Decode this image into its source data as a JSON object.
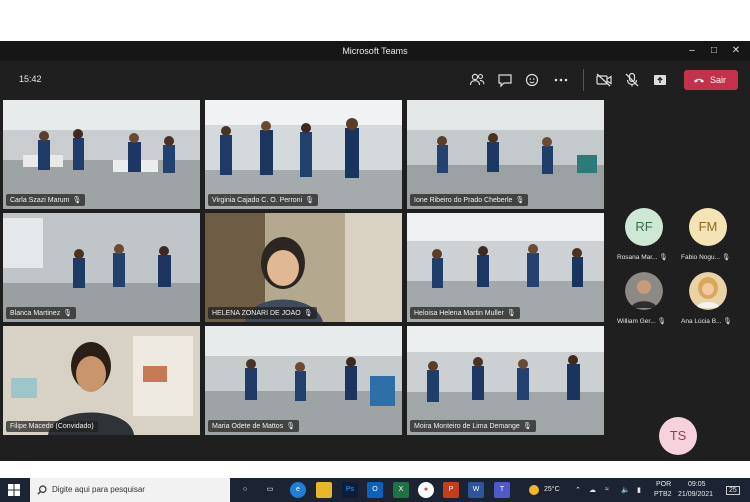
{
  "window": {
    "title": "Microsoft Teams"
  },
  "toolbar": {
    "time": "15:42",
    "leave_label": "Sair"
  },
  "participants_grid": [
    {
      "name": "Carla Szazi Marum"
    },
    {
      "name": "Virginia Cajado C. O. Perroni"
    },
    {
      "name": "Ione Ribeiro do Prado Cheberle"
    },
    {
      "name": "Blanca Martinez"
    },
    {
      "name": "HELENA ZONARI DE JOAO"
    },
    {
      "name": "Heloisa Helena Martin Muller"
    },
    {
      "name": "Filipe Macedo (Convidado)"
    },
    {
      "name": "Maria Odete de Mattos"
    },
    {
      "name": "Moira Monteiro de Lima Demange"
    }
  ],
  "side_participants": [
    {
      "initials": "RF",
      "name": "Rosana Mar...",
      "color": "#cfe8d6"
    },
    {
      "initials": "FM",
      "name": "Fabio Nogu...",
      "color": "#f4e3b5"
    },
    {
      "initials": "",
      "name": "William Ger..."
    },
    {
      "initials": "",
      "name": "Ana Lúcia B..."
    }
  ],
  "self_avatar": {
    "initials": "TS",
    "color": "#f6d3dc"
  },
  "taskbar": {
    "search_placeholder": "Digite aqui para pesquisar",
    "weather": "25°C",
    "lang": "POR",
    "layout": "PTB2",
    "time": "09:05",
    "date": "21/09/2021",
    "notifications": "25"
  },
  "colors": {
    "leave": "#c4314b",
    "frame": "#1f1f1f",
    "active_tile": "#8b8cf0"
  }
}
